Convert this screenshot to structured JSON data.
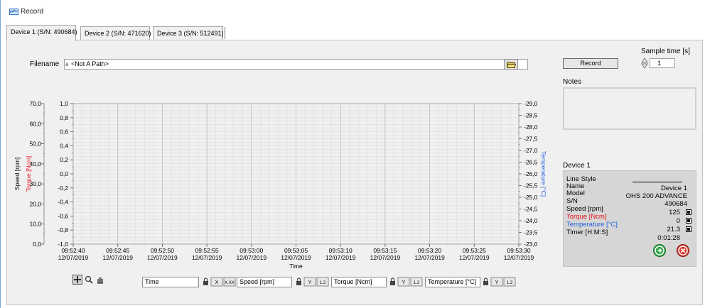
{
  "window": {
    "title": "Record",
    "tabs": [
      {
        "label": "Device 1 (S/N: 490684)",
        "active": true
      },
      {
        "label": "Device 2 (S/N: 471620)",
        "active": false
      },
      {
        "label": "Device 3 (S/N: 512491)",
        "active": false
      }
    ]
  },
  "file": {
    "label": "Filename",
    "path_glyph": "ə",
    "path": "<Not A Path>"
  },
  "record": {
    "button_label": "Record",
    "sample_time_label": "Sample time [s]",
    "sample_time_value": "1"
  },
  "notes": {
    "label": "Notes",
    "value": ""
  },
  "device_panel": {
    "heading": "Device 1",
    "rows": [
      {
        "label": "Line Style",
        "value": "",
        "color": "#000000"
      },
      {
        "label": "Name",
        "value": "Device 1",
        "color": "#000000"
      },
      {
        "label": "Model",
        "value": "OHS 200 ADVANCE",
        "color": "#000000"
      },
      {
        "label": "S/N",
        "value": "490684",
        "color": "#000000"
      },
      {
        "label": "Speed [rpm]",
        "value": "125",
        "color": "#000000",
        "checked": true
      },
      {
        "label": "Torque [Ncm]",
        "value": "0",
        "color": "#e8141e",
        "checked": true
      },
      {
        "label": "Temperature [°C]",
        "value": "21.3",
        "color": "#1f5fe0",
        "checked": true
      },
      {
        "label": "Timer [H:M:S]",
        "value": "0:01:28",
        "color": "#000000"
      }
    ],
    "start_button_icon": "play-arrow-icon",
    "stop_button_icon": "close-icon"
  },
  "chart_data": {
    "type": "line",
    "xlabel": "Time",
    "x_ticks": [
      {
        "time": "09:52:40",
        "date": "12/07/2019"
      },
      {
        "time": "09:52:45",
        "date": "12/07/2019"
      },
      {
        "time": "09:52:50",
        "date": "12/07/2019"
      },
      {
        "time": "09:52:55",
        "date": "12/07/2019"
      },
      {
        "time": "09:53:00",
        "date": "12/07/2019"
      },
      {
        "time": "09:53:05",
        "date": "12/07/2019"
      },
      {
        "time": "09:53:10",
        "date": "12/07/2019"
      },
      {
        "time": "09:53:15",
        "date": "12/07/2019"
      },
      {
        "time": "09:53:20",
        "date": "12/07/2019"
      },
      {
        "time": "09:53:25",
        "date": "12/07/2019"
      },
      {
        "time": "09:53:30",
        "date": "12/07/2019"
      }
    ],
    "y_axes": [
      {
        "label": "Speed [rpm]",
        "color": "#000000",
        "side": "left-outer",
        "ylim": [
          0,
          70
        ],
        "ticks": [
          "0,0",
          "10,0",
          "20,0",
          "30,0",
          "40,0",
          "50,0",
          "60,0",
          "70,0"
        ]
      },
      {
        "label": "Torque [Ncm]",
        "color": "#e8141e",
        "side": "left-inner",
        "ylim": [
          -1.0,
          1.0
        ],
        "ticks": [
          "-1,0",
          "-0,8",
          "-0,6",
          "-0,4",
          "-0,2",
          "0,0",
          "0,2",
          "0,4",
          "0,6",
          "0,8",
          "1,0"
        ]
      },
      {
        "label": "Temperature [°C]",
        "color": "#1f5fe0",
        "side": "right",
        "ylim": [
          -23.0,
          -29.0
        ],
        "ticks": [
          "-23,0",
          "-23,5",
          "-24,0",
          "-24,5",
          "-25,0",
          "-25,5",
          "-26,0",
          "-26,5",
          "-27,0",
          "-27,5",
          "-28,0",
          "-28,5",
          "-29,0"
        ]
      }
    ],
    "grid": true,
    "series": []
  },
  "legend": {
    "x_name": "Time",
    "speed_name": "Speed [rpm]",
    "torque_name": "Torque [Ncm]",
    "temp_name": "Temperature [°C]",
    "x_fmt_1": "X.XX",
    "x_fmt_2": "",
    "y_fmt": "1.2",
    "tools": [
      "crosshair-icon",
      "zoom-icon",
      "pan-hand-icon"
    ]
  },
  "colors": {
    "panel_bg": "#f0f0f0",
    "grid": "#d8d8d8",
    "torque": "#e8141e",
    "temperature": "#1f5fe0"
  }
}
